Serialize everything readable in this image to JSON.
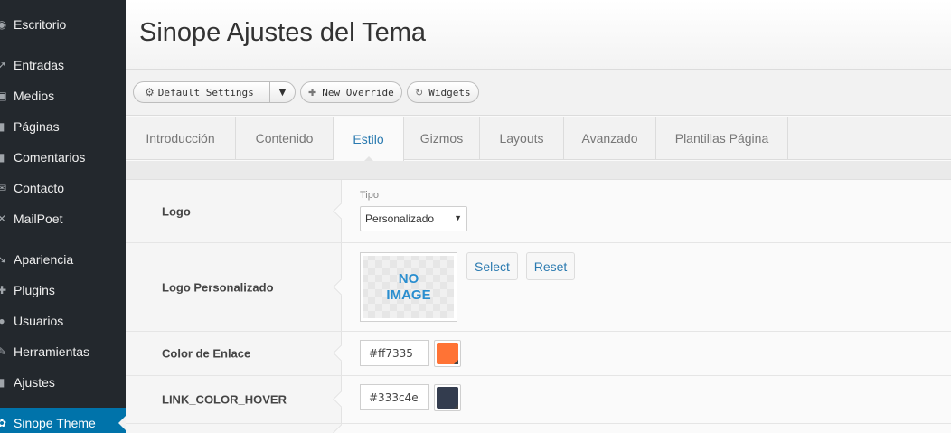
{
  "colors": {
    "sidebar_bg": "#23282d",
    "active": "#0073aa",
    "link": "#2a7ab0"
  },
  "sidebar": {
    "items": [
      {
        "label": "Escritorio",
        "icon": "dashboard-icon"
      },
      {
        "label": "Entradas",
        "icon": "pin-icon"
      },
      {
        "label": "Medios",
        "icon": "media-icon"
      },
      {
        "label": "Páginas",
        "icon": "pages-icon"
      },
      {
        "label": "Comentarios",
        "icon": "comments-icon"
      },
      {
        "label": "Contacto",
        "icon": "mail-icon"
      },
      {
        "label": "MailPoet",
        "icon": "mailpoet-icon"
      },
      {
        "label": "Apariencia",
        "icon": "brush-icon"
      },
      {
        "label": "Plugins",
        "icon": "plug-icon"
      },
      {
        "label": "Usuarios",
        "icon": "users-icon"
      },
      {
        "label": "Herramientas",
        "icon": "tools-icon"
      },
      {
        "label": "Ajustes",
        "icon": "settings-icon"
      },
      {
        "label": "Sinope Theme",
        "icon": "theme-icon"
      }
    ]
  },
  "header": {
    "title": "Sinope Ajustes del Tema"
  },
  "toolbar": {
    "settings_select": "Default Settings",
    "new_override": "New Override",
    "widgets": "Widgets"
  },
  "tabs": [
    {
      "label": "Introducción"
    },
    {
      "label": "Contenido"
    },
    {
      "label": "Estilo"
    },
    {
      "label": "Gizmos"
    },
    {
      "label": "Layouts"
    },
    {
      "label": "Avanzado"
    },
    {
      "label": "Plantillas Página"
    }
  ],
  "rows": {
    "logo": {
      "label": "Logo",
      "tipo_label": "Tipo",
      "tipo_value": "Personalizado"
    },
    "logo_custom": {
      "label": "Logo Personalizado",
      "no_image_line1": "NO",
      "no_image_line2": "IMAGE",
      "select": "Select",
      "reset": "Reset"
    },
    "link_color": {
      "label": "Color de Enlace",
      "hex": "#ff7335",
      "swatch": "#ff7335"
    },
    "link_hover": {
      "label": "LINK_COLOR_HOVER",
      "hex": "#333c4e",
      "swatch": "#333c4e"
    }
  }
}
